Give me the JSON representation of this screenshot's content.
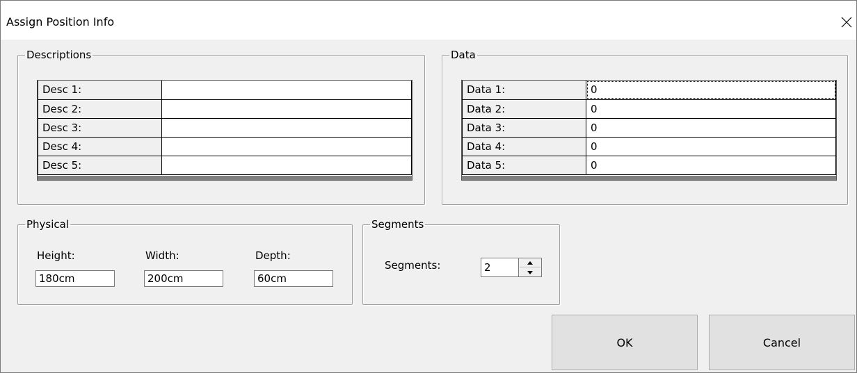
{
  "window": {
    "title": "Assign Position Info",
    "close_icon": "close-icon"
  },
  "descriptions": {
    "legend": "Descriptions",
    "rows": [
      {
        "label": "Desc 1:",
        "value": ""
      },
      {
        "label": "Desc 2:",
        "value": ""
      },
      {
        "label": "Desc 3:",
        "value": ""
      },
      {
        "label": "Desc 4:",
        "value": ""
      },
      {
        "label": "Desc 5:",
        "value": ""
      }
    ]
  },
  "data_group": {
    "legend": "Data",
    "rows": [
      {
        "label": "Data 1:",
        "value": "0"
      },
      {
        "label": "Data 2:",
        "value": "0"
      },
      {
        "label": "Data 3:",
        "value": "0"
      },
      {
        "label": "Data 4:",
        "value": "0"
      },
      {
        "label": "Data 5:",
        "value": "0"
      }
    ]
  },
  "physical": {
    "legend": "Physical",
    "height_label": "Height:",
    "height_value": "180cm",
    "width_label": "Width:",
    "width_value": "200cm",
    "depth_label": "Depth:",
    "depth_value": "60cm"
  },
  "segments": {
    "legend": "Segments",
    "label": "Segments:",
    "value": "2"
  },
  "buttons": {
    "ok": "OK",
    "cancel": "Cancel"
  }
}
